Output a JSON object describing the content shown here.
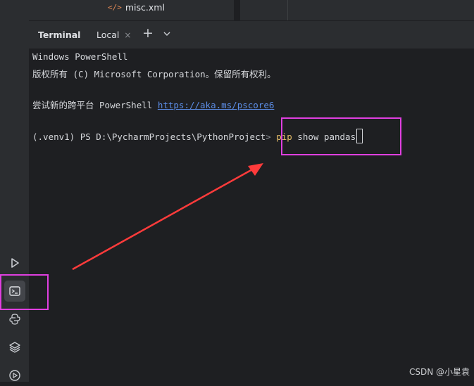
{
  "file_tree": {
    "file_name": "misc.xml",
    "file_icon_glyph": "</>"
  },
  "tabs": {
    "panel_title": "Terminal",
    "active_tab": "Local",
    "close_glyph": "×",
    "add_glyph": "+"
  },
  "terminal": {
    "line1": "Windows PowerShell",
    "line2": "版权所有 (C) Microsoft Corporation。保留所有权利。",
    "line3_prefix": "尝试新的跨平台 PowerShell ",
    "line3_link": "https://aka.ms/pscore6",
    "prompt": "(.venv1) PS D:\\PycharmProjects\\PythonProject",
    "prompt_arrow": ">",
    "cmd_pip": "pip",
    "cmd_rest": " show pandas"
  },
  "sidebar_icons": [
    "run-icon",
    "terminal-icon",
    "python-console-icon",
    "layers-icon",
    "services-icon"
  ],
  "colors": {
    "highlight": "#e03fe0",
    "arrow": "#ff3b3b",
    "link": "#5c8de6",
    "command": "#e8bf6a"
  },
  "watermark": "CSDN @小星袁"
}
